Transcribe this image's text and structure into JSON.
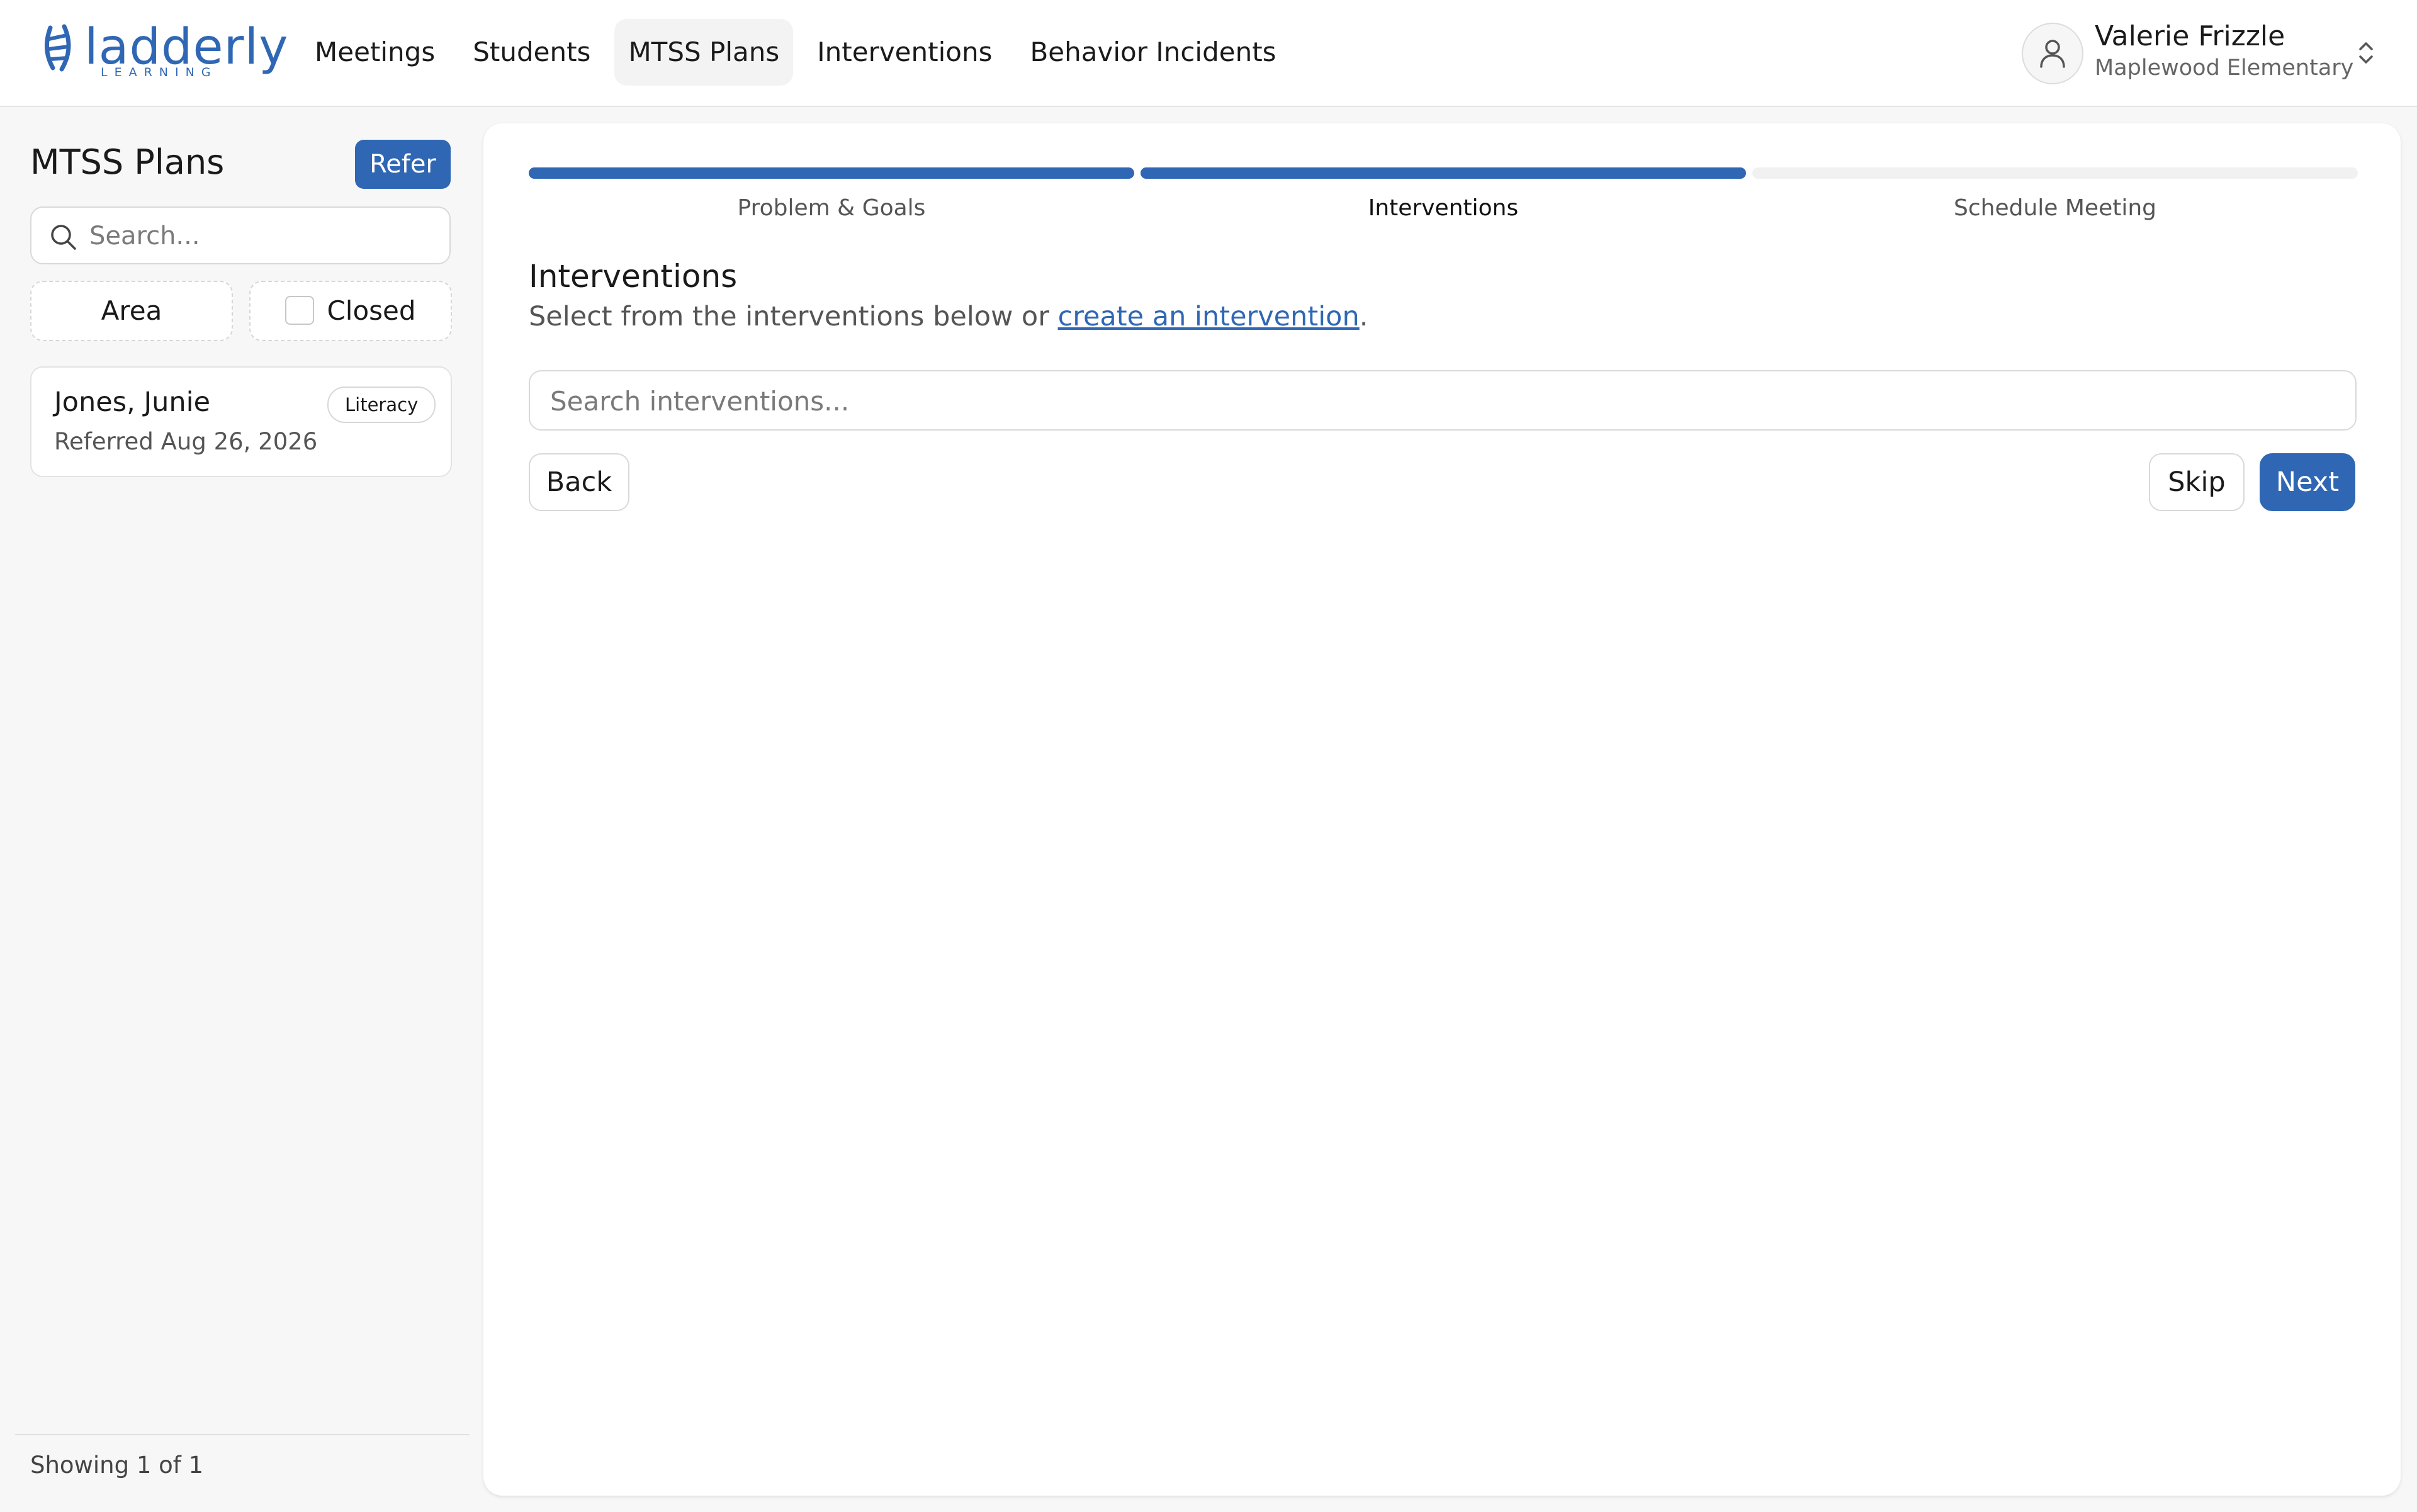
{
  "app": {
    "logo_text": "ladderly",
    "logo_subtext": "LEARNING",
    "brand_color": "#2f67b4"
  },
  "nav": {
    "items": [
      {
        "label": "Meetings",
        "active": false
      },
      {
        "label": "Students",
        "active": false
      },
      {
        "label": "MTSS Plans",
        "active": true
      },
      {
        "label": "Interventions",
        "active": false
      },
      {
        "label": "Behavior Incidents",
        "active": false
      }
    ]
  },
  "user": {
    "name": "Valerie Frizzle",
    "school": "Maplewood Elementary",
    "avatar_icon": "user-icon",
    "switch_icon": "chevron-up-down-icon"
  },
  "sidebar": {
    "title": "MTSS Plans",
    "refer_label": "Refer",
    "search_placeholder": "Search...",
    "filters": {
      "area_label": "Area",
      "closed_label": "Closed",
      "closed_checked": false
    },
    "plans": [
      {
        "name": "Jones, Junie",
        "referred": "Referred Aug 26, 2026",
        "badge": "Literacy"
      }
    ],
    "footer": "Showing 1 of 1"
  },
  "wizard": {
    "steps": [
      {
        "label": "Problem & Goals",
        "complete": true
      },
      {
        "label": "Interventions",
        "complete": true,
        "current": true
      },
      {
        "label": "Schedule Meeting",
        "complete": false
      }
    ],
    "section_title": "Interventions",
    "description_prefix": "Select from the interventions below or ",
    "description_link": "create an intervention",
    "description_suffix": ".",
    "search_placeholder": "Search interventions...",
    "back_label": "Back",
    "skip_label": "Skip",
    "next_label": "Next"
  }
}
